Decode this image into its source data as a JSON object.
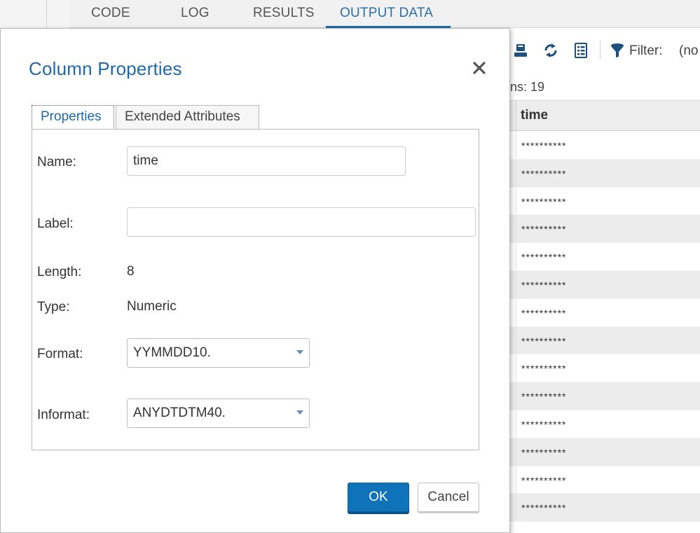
{
  "main_tabs": [
    {
      "label": "CODE"
    },
    {
      "label": "LOG"
    },
    {
      "label": "RESULTS"
    },
    {
      "label": "OUTPUT DATA"
    }
  ],
  "toolbar": {
    "filter_label": "Filter:",
    "filter_value": "(no"
  },
  "columns_count_text": "ns: 19",
  "grid": {
    "column_title": "time",
    "rows": [
      "**********",
      "**********",
      "**********",
      "**********",
      "**********",
      "**********",
      "**********",
      "**********",
      "**********",
      "**********",
      "**********",
      "**********",
      "**********",
      "**********"
    ]
  },
  "dialog": {
    "title": "Column Properties",
    "tabs": [
      {
        "label": "Properties"
      },
      {
        "label": "Extended Attributes"
      }
    ],
    "fields": {
      "name_label": "Name:",
      "name_value": "time",
      "label_label": "Label:",
      "label_value": "",
      "length_label": "Length:",
      "length_value": "8",
      "type_label": "Type:",
      "type_value": "Numeric",
      "format_label": "Format:",
      "format_value": "YYMMDD10.",
      "informat_label": "Informat:",
      "informat_value": "ANYDTDTM40."
    },
    "ok_label": "OK",
    "cancel_label": "Cancel"
  },
  "colors": {
    "accent": "#1f6aa8",
    "primary_button": "#0e73b9",
    "icon_blue": "#1d4f7f"
  },
  "icons": [
    "save-icon",
    "refresh-icon",
    "column-list-icon",
    "filter-icon",
    "close-icon"
  ]
}
